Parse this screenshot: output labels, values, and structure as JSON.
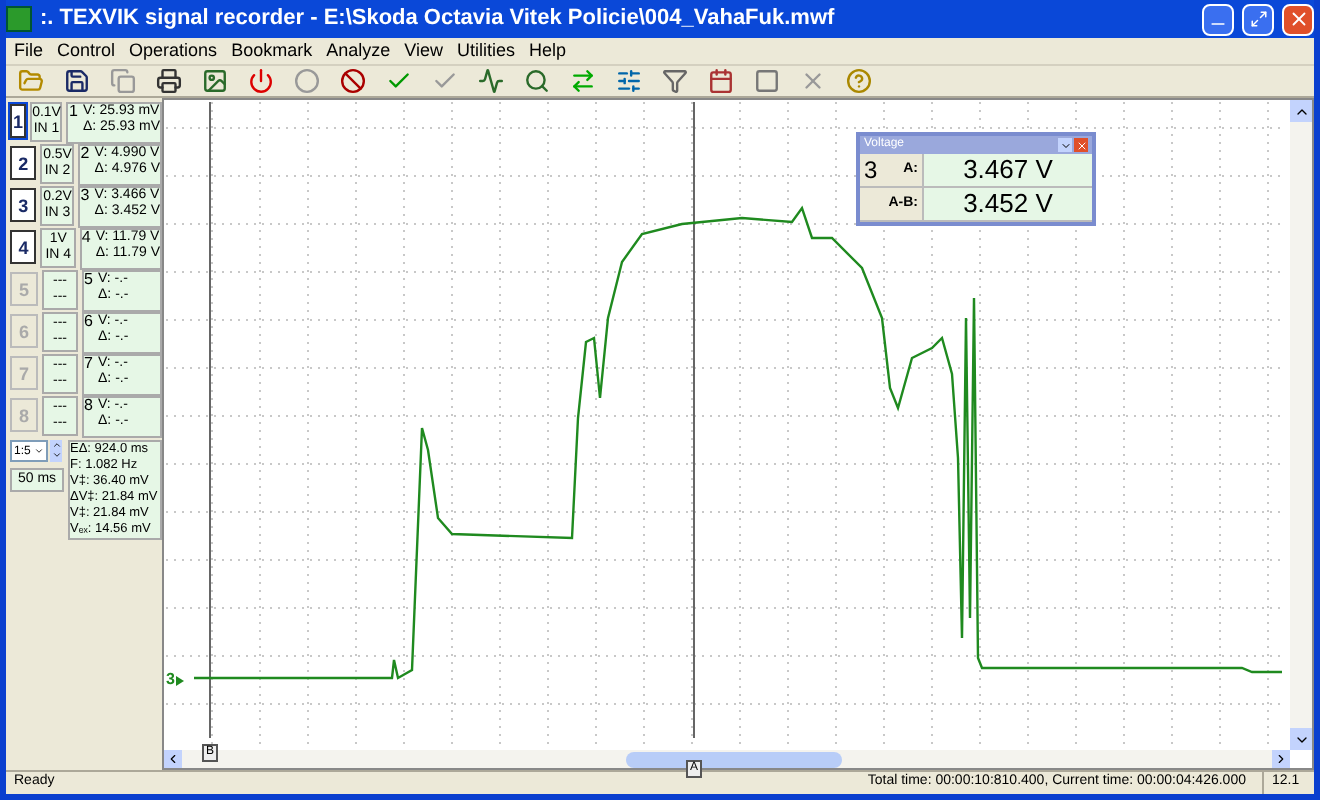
{
  "window": {
    "title": ":. TEXVIK  signal recorder - E:\\Skoda Octavia Vitek Policie\\004_VahaFuk.mwf"
  },
  "menu": [
    "File",
    "Control",
    "Operations",
    "Bookmark",
    "Analyze",
    "View",
    "Utilities",
    "Help"
  ],
  "channels": [
    {
      "number": "1",
      "scale": "0.1V",
      "input": "IN 1",
      "enabled": true,
      "selected": true,
      "panel_number": "1",
      "readings": [
        "V: 25.93 mV",
        "Δ: 25.93 mV"
      ]
    },
    {
      "number": "2",
      "scale": "0.5V",
      "input": "IN 2",
      "enabled": true,
      "selected": false,
      "panel_number": "2",
      "readings": [
        "V: 4.990 V",
        "Δ: 4.976 V"
      ]
    },
    {
      "number": "3",
      "scale": "0.2V",
      "input": "IN 3",
      "enabled": true,
      "selected": false,
      "panel_number": "3",
      "readings": [
        "V: 3.466 V",
        "Δ: 3.452 V"
      ]
    },
    {
      "number": "4",
      "scale": "1V",
      "input": "IN 4",
      "enabled": true,
      "selected": false,
      "panel_number": "4",
      "readings": [
        "V: 11.79 V",
        "Δ: 11.79 V"
      ]
    },
    {
      "number": "5",
      "scale": "---",
      "input": "---",
      "enabled": false,
      "selected": false,
      "panel_number": "5",
      "readings": [
        "V: -.-",
        "Δ: -.-"
      ]
    },
    {
      "number": "6",
      "scale": "---",
      "input": "---",
      "enabled": false,
      "selected": false,
      "panel_number": "6",
      "readings": [
        "V: -.-",
        "Δ: -.-"
      ]
    },
    {
      "number": "7",
      "scale": "---",
      "input": "---",
      "enabled": false,
      "selected": false,
      "panel_number": "7",
      "readings": [
        "V: -.-",
        "Δ: -.-"
      ]
    },
    {
      "number": "8",
      "scale": "---",
      "input": "---",
      "enabled": false,
      "selected": false,
      "panel_number": "8",
      "readings": [
        "V: -.-",
        "Δ: -.-"
      ]
    }
  ],
  "zoom": {
    "value": "1:5"
  },
  "timebase": "50 ms",
  "time_readings": [
    "EΔ: 924.0 ms",
    "F: 1.082 Hz"
  ],
  "voltage_readings": [
    "V‡: 36.40 mV",
    "ΔV‡: 21.84 mV",
    "V‡: 21.84 mV",
    "Vₑₓ: 14.56 mV"
  ],
  "plot": {
    "trace_label": "3",
    "cursors": [
      {
        "label": "B"
      },
      {
        "label": "A"
      }
    ]
  },
  "voltage_window": {
    "title": "Voltage",
    "channel": "3",
    "rows": [
      {
        "label": "A:",
        "value": "3.467 V"
      },
      {
        "label": "A-B:",
        "value": "3.452 V"
      }
    ]
  },
  "status_bar": {
    "message": "Ready",
    "times": "Total time: 00:00:10:810.400, Current time: 00:00:04:426.000",
    "zoom": "12.1"
  }
}
